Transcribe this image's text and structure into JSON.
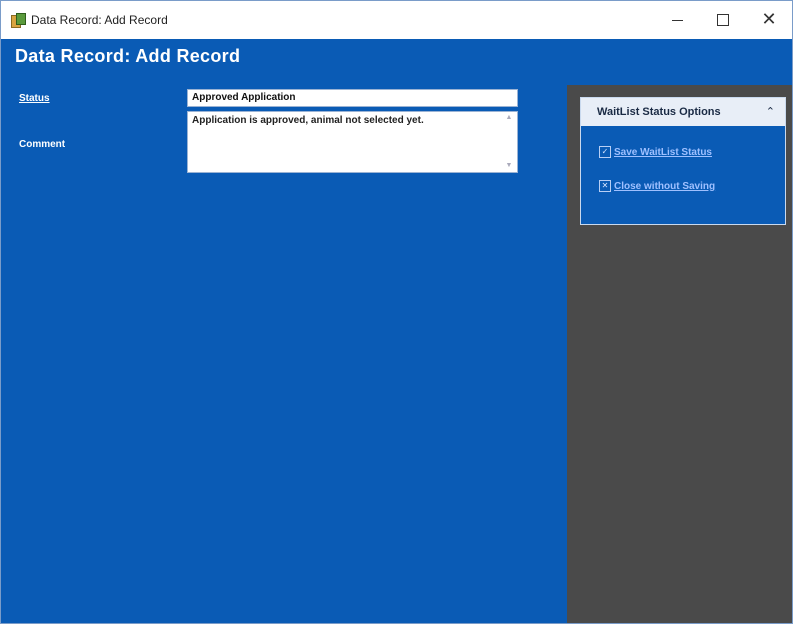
{
  "window": {
    "title": "Data Record: Add Record",
    "controls": {
      "minimize": "minimize",
      "maximize": "maximize",
      "close": "✕"
    }
  },
  "header": {
    "title": "Data Record: Add Record"
  },
  "form": {
    "status_label": "Status",
    "status_value": "Approved Application",
    "comment_label": "Comment",
    "comment_value": "Application is approved, animal not selected yet."
  },
  "options_panel": {
    "title": "WaitList Status Options",
    "collapse_glyph": "⌃",
    "items": [
      {
        "label": "Save WaitList Status",
        "icon": "save-check-icon",
        "glyph": "✓"
      },
      {
        "label": "Close without Saving",
        "icon": "close-x-icon",
        "glyph": "✕"
      }
    ]
  },
  "colors": {
    "brand_blue": "#0a5bb5",
    "panel_gray": "#4a4a4a",
    "link_blue": "#9fc0ff"
  }
}
